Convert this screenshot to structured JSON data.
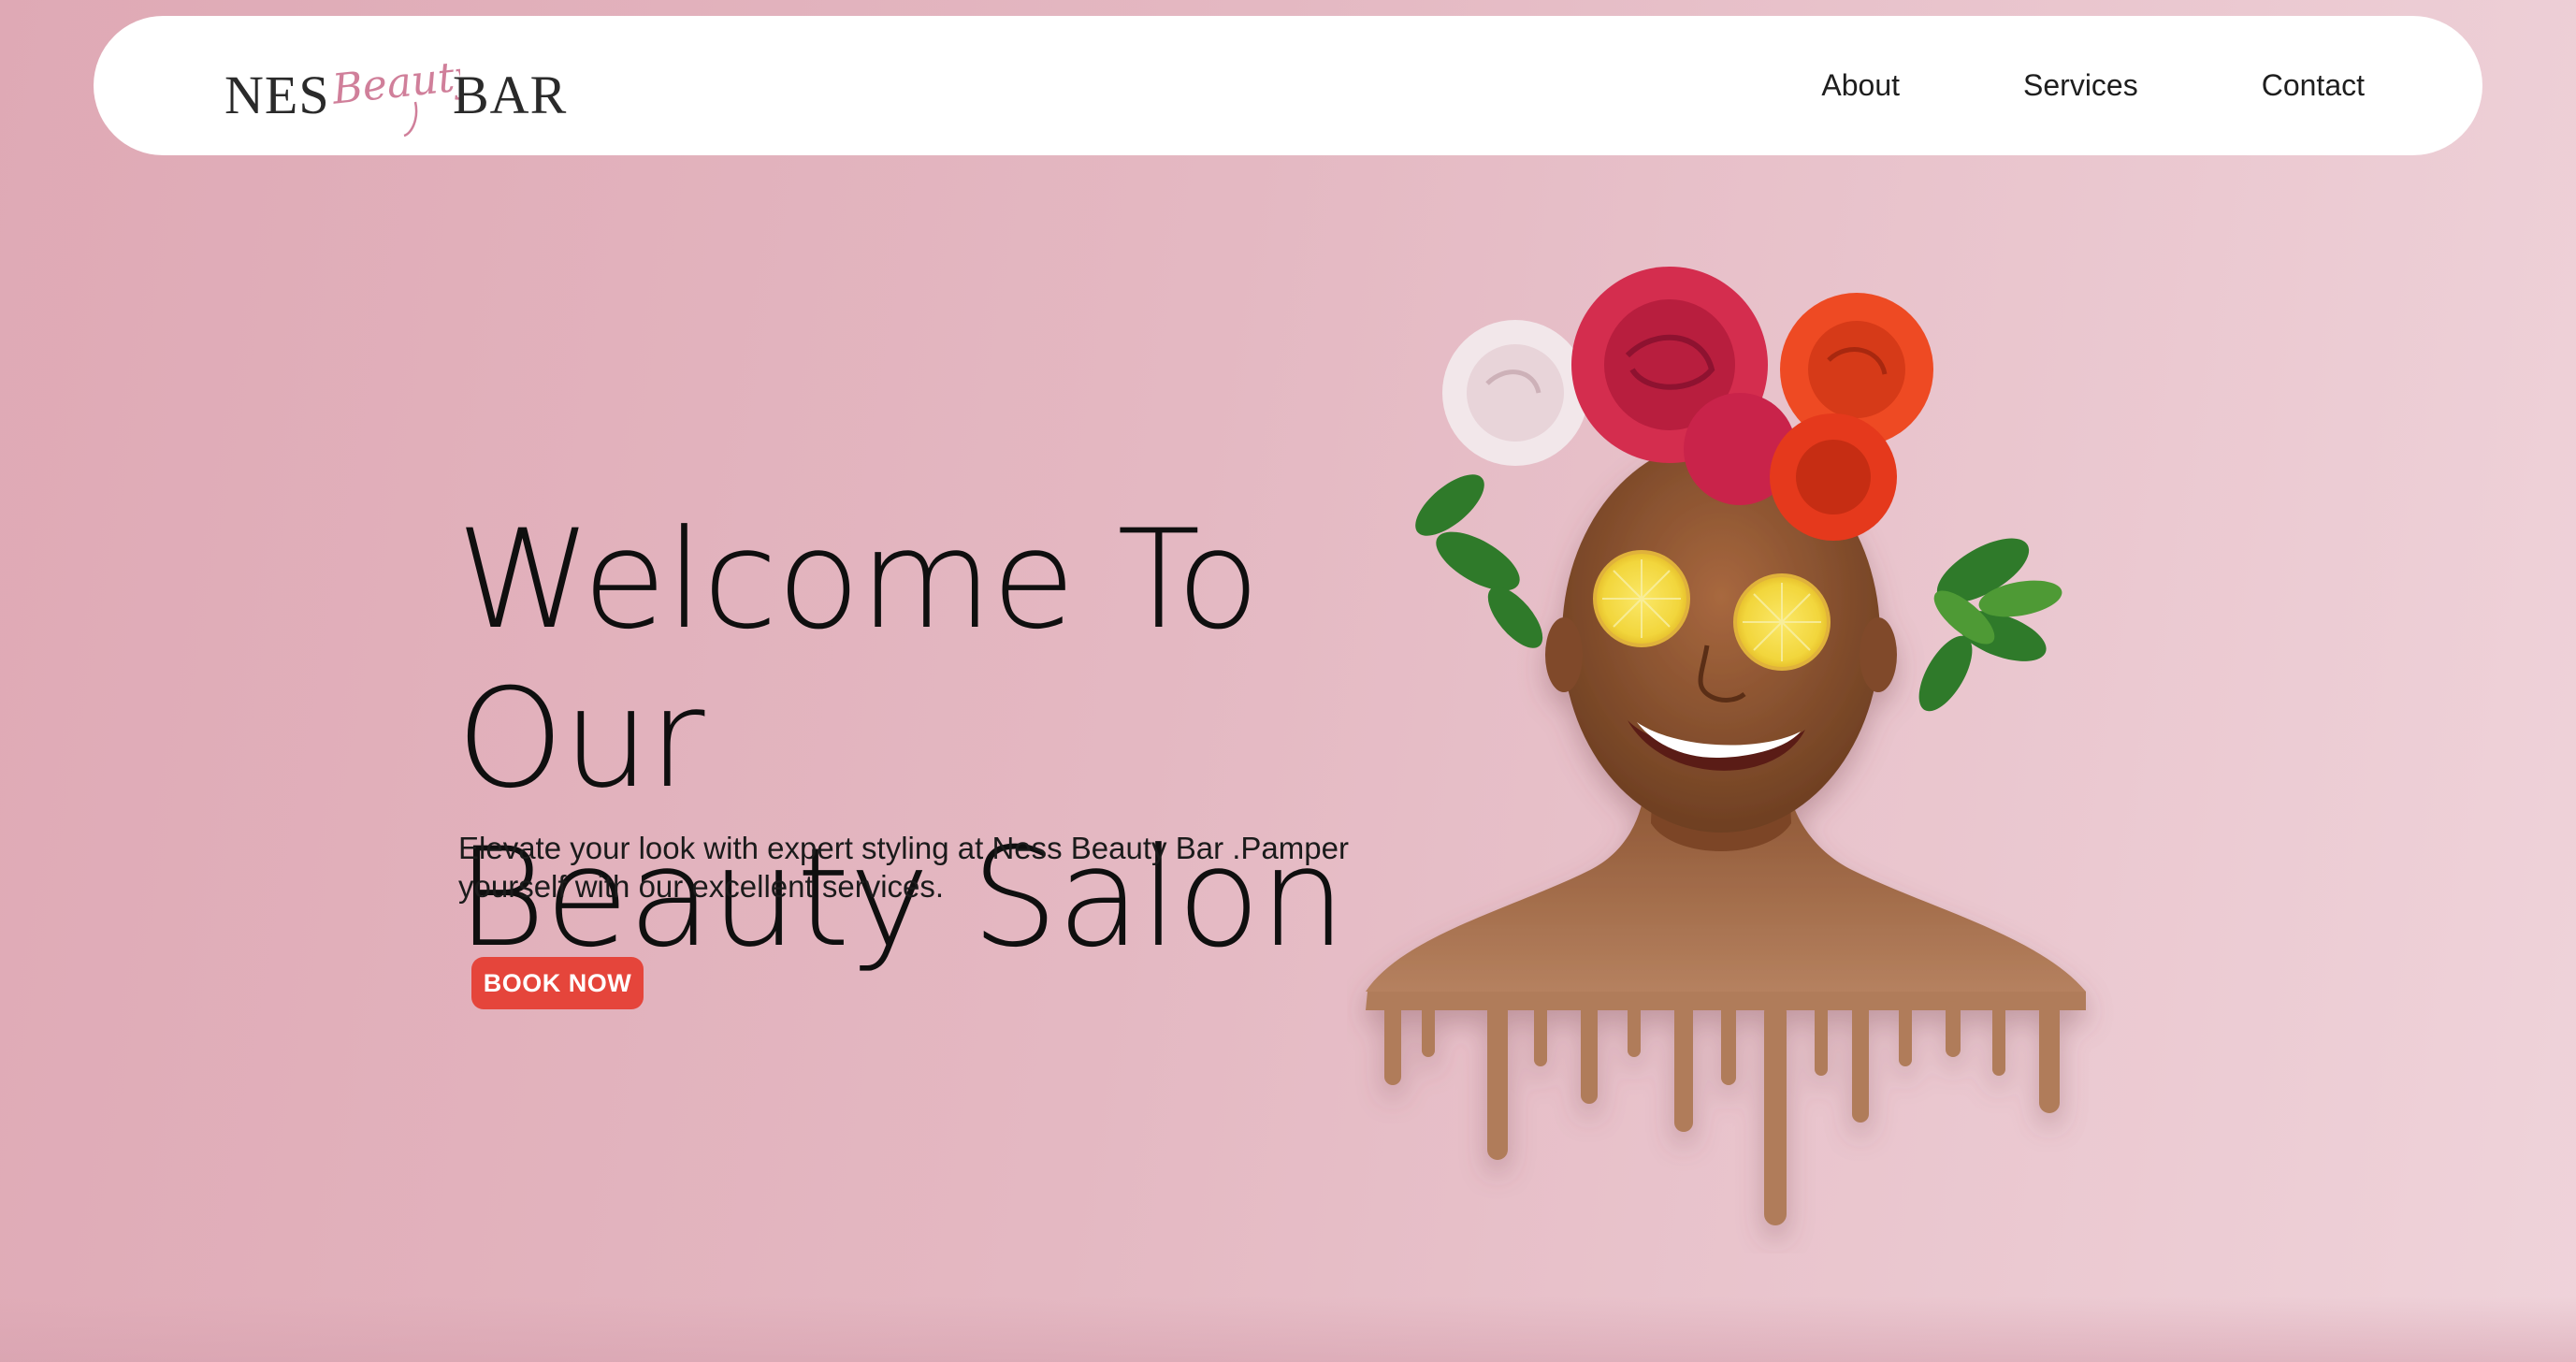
{
  "brand": {
    "left_word": "NES",
    "script_word": "Beauty",
    "right_word": "BAR",
    "accent_color": "#d07f9a"
  },
  "nav": {
    "items": [
      {
        "label": "About"
      },
      {
        "label": "Services"
      },
      {
        "label": "Contact"
      }
    ]
  },
  "hero": {
    "title_line1": "Welcome To Our",
    "title_line2": "Beauty Salon",
    "description_line1": "Elevate your look with expert styling at Ness Beauty Bar .Pamper",
    "description_line2": "yourself with our excellent services.",
    "cta_label": "BOOK NOW",
    "cta_color": "#e5453b"
  },
  "illustration": {
    "subject": "smiling woman with flower crown and lemon slices over eyes, dripping shoulders",
    "icon": "portrait-illustration"
  },
  "colors": {
    "background_start": "#dfa9b5",
    "background_end": "#efd3da",
    "navbar": "#ffffff"
  }
}
